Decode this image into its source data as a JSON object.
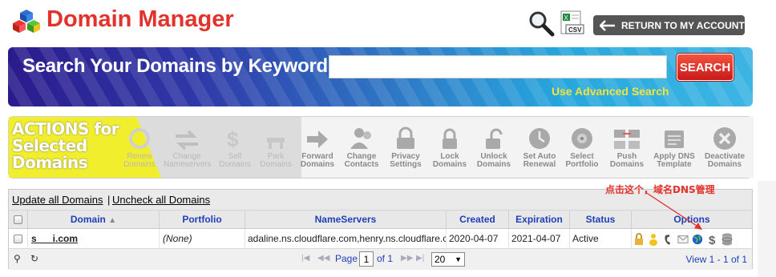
{
  "header": {
    "title": "Domain Manager",
    "search_icon": "magnifier-icon",
    "csv_icon": "csv-icon",
    "csv_label": "CSV",
    "return_button": "RETURN TO MY ACCOUNT"
  },
  "search": {
    "heading": "Search Your Domains by Keyword",
    "input_value": "",
    "button": "SEARCH",
    "advanced_link": "Use Advanced Search"
  },
  "actions": {
    "label_line1": "ACTIONS for",
    "label_line2": "Selected",
    "label_line3": "Domains",
    "items": [
      {
        "l1": "Renew",
        "l2": "Domains",
        "icon": "renew-icon"
      },
      {
        "l1": "Change",
        "l2": "Nameservers",
        "icon": "change-nameservers-icon"
      },
      {
        "l1": "Sell",
        "l2": "Domains",
        "icon": "sell-icon"
      },
      {
        "l1": "Park",
        "l2": "Domains",
        "icon": "park-icon"
      },
      {
        "l1": "Forward",
        "l2": "Domains",
        "icon": "forward-icon"
      },
      {
        "l1": "Change",
        "l2": "Contacts",
        "icon": "contacts-icon"
      },
      {
        "l1": "Privacy",
        "l2": "Settings",
        "icon": "privacy-icon"
      },
      {
        "l1": "Lock",
        "l2": "Domains",
        "icon": "lock-icon"
      },
      {
        "l1": "Unlock",
        "l2": "Domains",
        "icon": "unlock-icon"
      },
      {
        "l1": "Set Auto",
        "l2": "Renewal",
        "icon": "auto-renew-icon"
      },
      {
        "l1": "Select",
        "l2": "Portfolio",
        "icon": "portfolio-icon"
      },
      {
        "l1": "Push",
        "l2": "Domains",
        "icon": "push-icon"
      },
      {
        "l1": "Apply DNS",
        "l2": "Template",
        "icon": "dns-template-icon"
      },
      {
        "l1": "Deactivate",
        "l2": "Domains",
        "icon": "deactivate-icon"
      }
    ]
  },
  "annotation": "点击这个，域名DNS管理",
  "grid": {
    "update_all": "Update all Domains",
    "separator": "|",
    "uncheck_all": "Uncheck all Domains",
    "columns": {
      "domain": "Domain",
      "portfolio": "Portfolio",
      "nameservers": "NameServers",
      "created": "Created",
      "expiration": "Expiration",
      "status": "Status",
      "options": "Options"
    },
    "row": {
      "domain": "s      i.com",
      "portfolio": "(None)",
      "nameservers": "adaline.ns.cloudflare.com,henry.ns.cloudflare.com",
      "created": "2020-04-07",
      "expiration": "2021-04-07",
      "status": "Active",
      "option_icons": [
        "lock-icon",
        "person-icon",
        "phone-icon",
        "mail-icon",
        "globe-dns-icon",
        "dollar-icon",
        "database-icon"
      ]
    },
    "footer": {
      "page_label": "Page",
      "page_value": "1",
      "of_label": "of 1",
      "page_size": "20",
      "view_text": "View 1 - 1 of 1"
    }
  },
  "colors": {
    "title_red": "#e3322b",
    "search_button": "#d8241f",
    "advanced_yellow": "#f4e339",
    "header_blue": "#1f3fb8",
    "actions_yellow": "#f1ee2e"
  }
}
